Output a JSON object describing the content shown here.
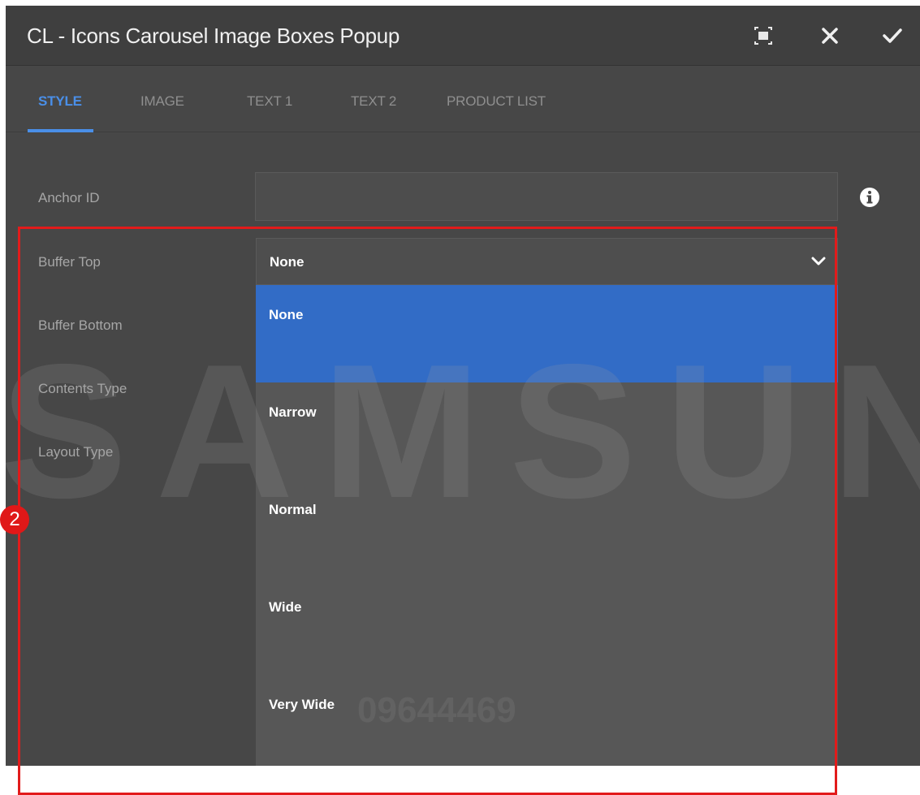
{
  "dialog": {
    "title": "CL - Icons Carousel Image Boxes Popup",
    "icons": [
      "fullscreen-icon",
      "close-icon",
      "checkmark-icon"
    ]
  },
  "tabs": [
    {
      "label": "STYLE",
      "active": true
    },
    {
      "label": "IMAGE",
      "active": false
    },
    {
      "label": "TEXT 1",
      "active": false
    },
    {
      "label": "TEXT 2",
      "active": false
    },
    {
      "label": "PRODUCT LIST",
      "active": false
    }
  ],
  "form": {
    "anchor_id": {
      "label": "Anchor ID",
      "value": ""
    },
    "buffer_top": {
      "label": "Buffer Top",
      "value": "None"
    },
    "buffer_bottom": {
      "label": "Buffer Bottom"
    },
    "contents_type": {
      "label": "Contents Type"
    },
    "layout_type": {
      "label": "Layout Type"
    }
  },
  "dropdown": {
    "options": [
      "None",
      "Narrow",
      "Normal",
      "Wide",
      "Very Wide"
    ],
    "selected_index": 0
  },
  "annotation": {
    "step": "2"
  },
  "watermark": {
    "text": "SAMSUNG",
    "number": "09644469"
  },
  "colors": {
    "accent": "#4a8fe8",
    "selected_option": "#326cc6",
    "highlight": "#e21b1b",
    "background": "#474747"
  }
}
